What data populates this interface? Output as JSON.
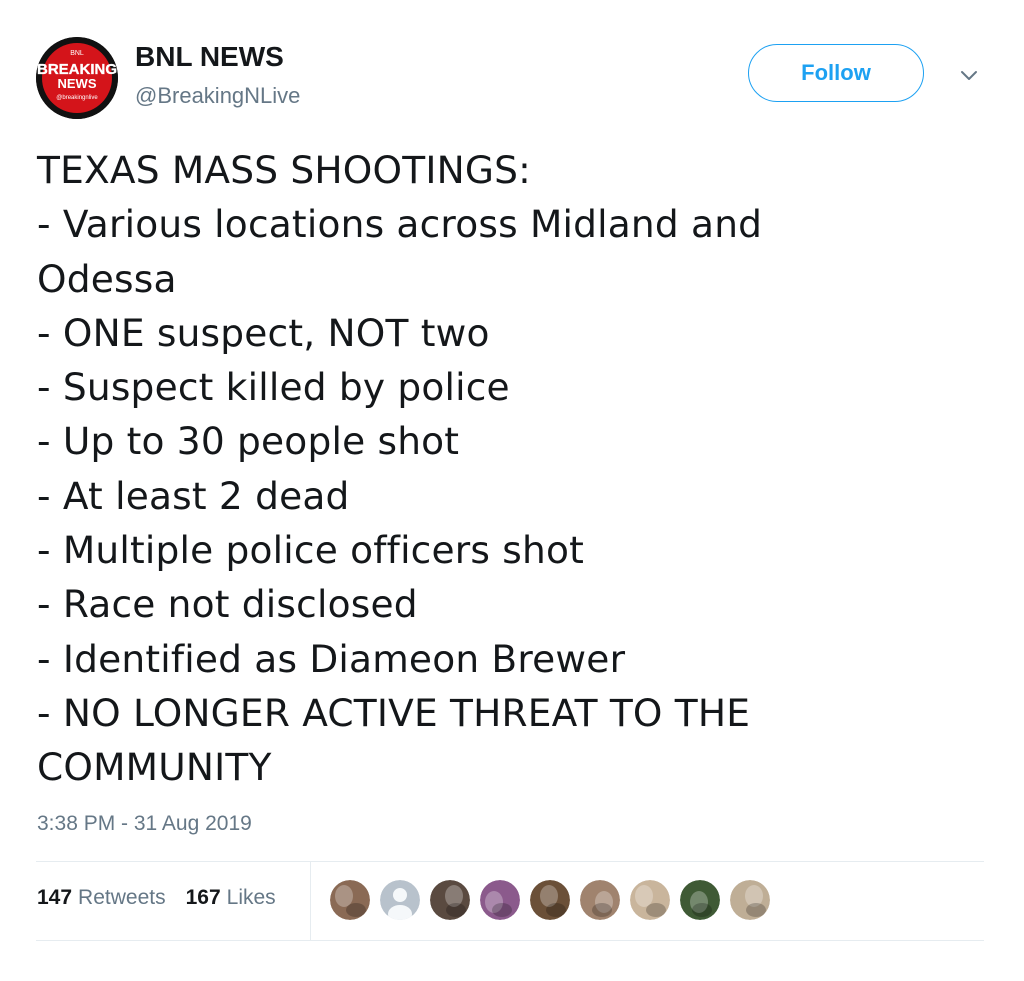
{
  "author": {
    "display_name": "BNL NEWS",
    "handle": "@BreakingNLive",
    "avatar": {
      "top_text": "BNL",
      "main_text_1": "BREAKING",
      "main_text_2": "NEWS",
      "bottom_text": "@breakingnlive"
    }
  },
  "follow_label": "Follow",
  "tweet_lines": [
    "TEXAS MASS SHOOTINGS:",
    "- Various locations across Midland and",
    "Odessa",
    "- ONE suspect, NOT two",
    "- Suspect killed by police",
    "- Up to 30 people shot",
    "- At least 2 dead",
    "- Multiple police officers shot",
    "- Race not disclosed",
    "- Identified as Diameon Brewer",
    "- NO LONGER ACTIVE THREAT TO THE",
    "COMMUNITY"
  ],
  "timestamp": "3:38 PM - 31 Aug 2019",
  "stats": {
    "retweets_count": "147",
    "retweets_label": "Retweets",
    "likes_count": "167",
    "likes_label": "Likes"
  },
  "likers": [
    {
      "icon": "user-photo-icon",
      "color": "#8a6a55"
    },
    {
      "icon": "default-avatar-icon",
      "color": "#b8c2cc"
    },
    {
      "icon": "user-photo-icon",
      "color": "#5a4a40"
    },
    {
      "icon": "user-photo-icon",
      "color": "#8b5a8c"
    },
    {
      "icon": "user-photo-icon",
      "color": "#6b5038"
    },
    {
      "icon": "user-photo-icon",
      "color": "#a0836e"
    },
    {
      "icon": "user-photo-icon",
      "color": "#c9b59c"
    },
    {
      "icon": "user-photo-icon",
      "color": "#3f5a35"
    },
    {
      "icon": "user-photo-icon",
      "color": "#bfae96"
    }
  ],
  "colors": {
    "accent": "#1da1f2",
    "text_primary": "#14171a",
    "text_secondary": "#657786",
    "divider": "#e6ecf0",
    "avatar_red": "#d4141a"
  }
}
